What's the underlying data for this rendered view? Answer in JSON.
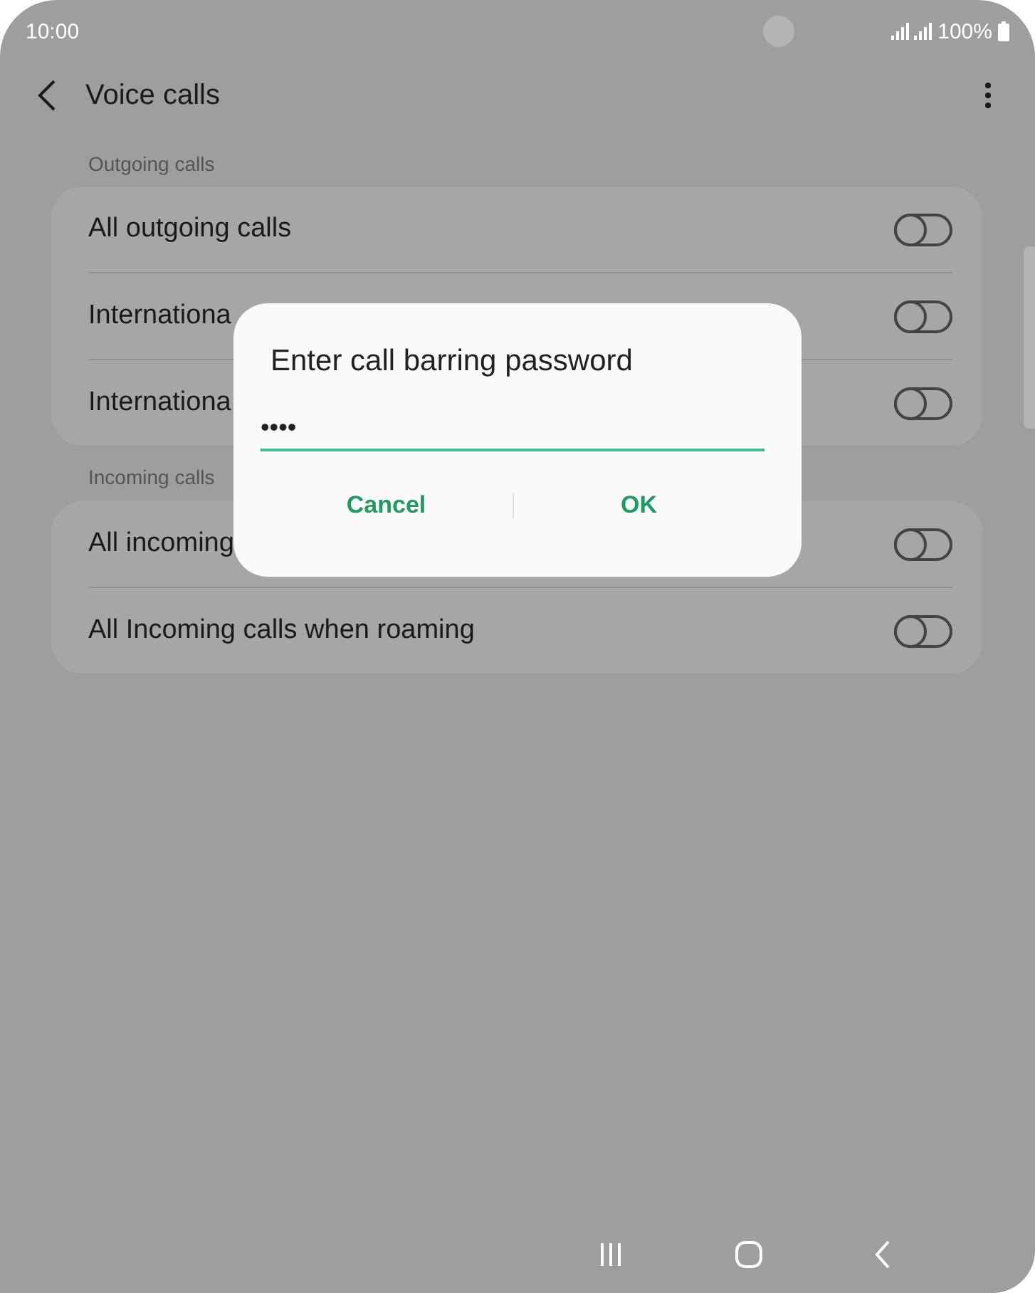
{
  "status_bar": {
    "time": "10:00",
    "battery": "100%"
  },
  "header": {
    "title": "Voice calls"
  },
  "sections": [
    {
      "label": "Outgoing calls",
      "rows": [
        {
          "label": "All outgoing calls",
          "on": false
        },
        {
          "label": "Internationa",
          "on": false
        },
        {
          "label": "Internationa",
          "on": false
        }
      ]
    },
    {
      "label": "Incoming calls",
      "rows": [
        {
          "label": "All incoming",
          "on": false
        },
        {
          "label": "All Incoming calls when roaming",
          "on": false
        }
      ]
    }
  ],
  "dialog": {
    "title": "Enter call barring password",
    "field": {
      "value": "••••"
    },
    "buttons": [
      "Cancel",
      "OK"
    ]
  }
}
